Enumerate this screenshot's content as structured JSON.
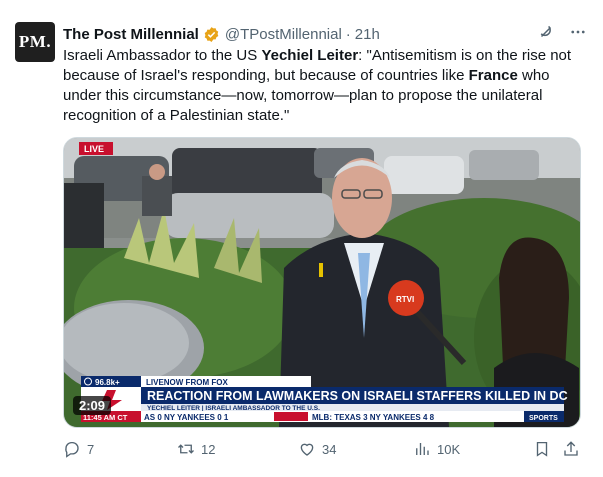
{
  "author": {
    "avatar_text": "PM.",
    "name": "The Post Millennial",
    "handle": "@TPostMillennial",
    "separator": "·",
    "time": "21h"
  },
  "tweet": {
    "t1": "Israeli Ambassador to the US ",
    "t2": "Yechiel Leiter",
    "t3": ": \"Antisemitism is on the rise not because of Israel's responding, but because of countries like ",
    "t4": "France",
    "t5": " who under this circumstance—now, tomorrow—plan to propose the unilateral recognition of a Palestinian state.\""
  },
  "video": {
    "duration": "2:09",
    "live_badge": "LIVE",
    "viewers": "96.8k+",
    "program": "LIVENOW FROM FOX",
    "headline": "REACTION FROM LAWMAKERS ON ISRAELI STAFFERS KILLED IN DC",
    "subhead": "YECHIEL LEITER | ISRAELI AMBASSADOR TO THE U.S.",
    "clock": "11:45 AM CT",
    "ticker": "AS  0  NY YANKEES  0  1",
    "ticker2": "MLB:  TEXAS  3  NY YANKEES  4  8",
    "sports": "SPORTS",
    "mic_brand": "RTVI"
  },
  "actions": {
    "replies": "7",
    "reposts": "12",
    "likes": "34",
    "views": "10K"
  },
  "colors": {
    "verified": "#e8a317",
    "fox_red": "#c8102e",
    "fox_blue": "#0a2a6b"
  }
}
